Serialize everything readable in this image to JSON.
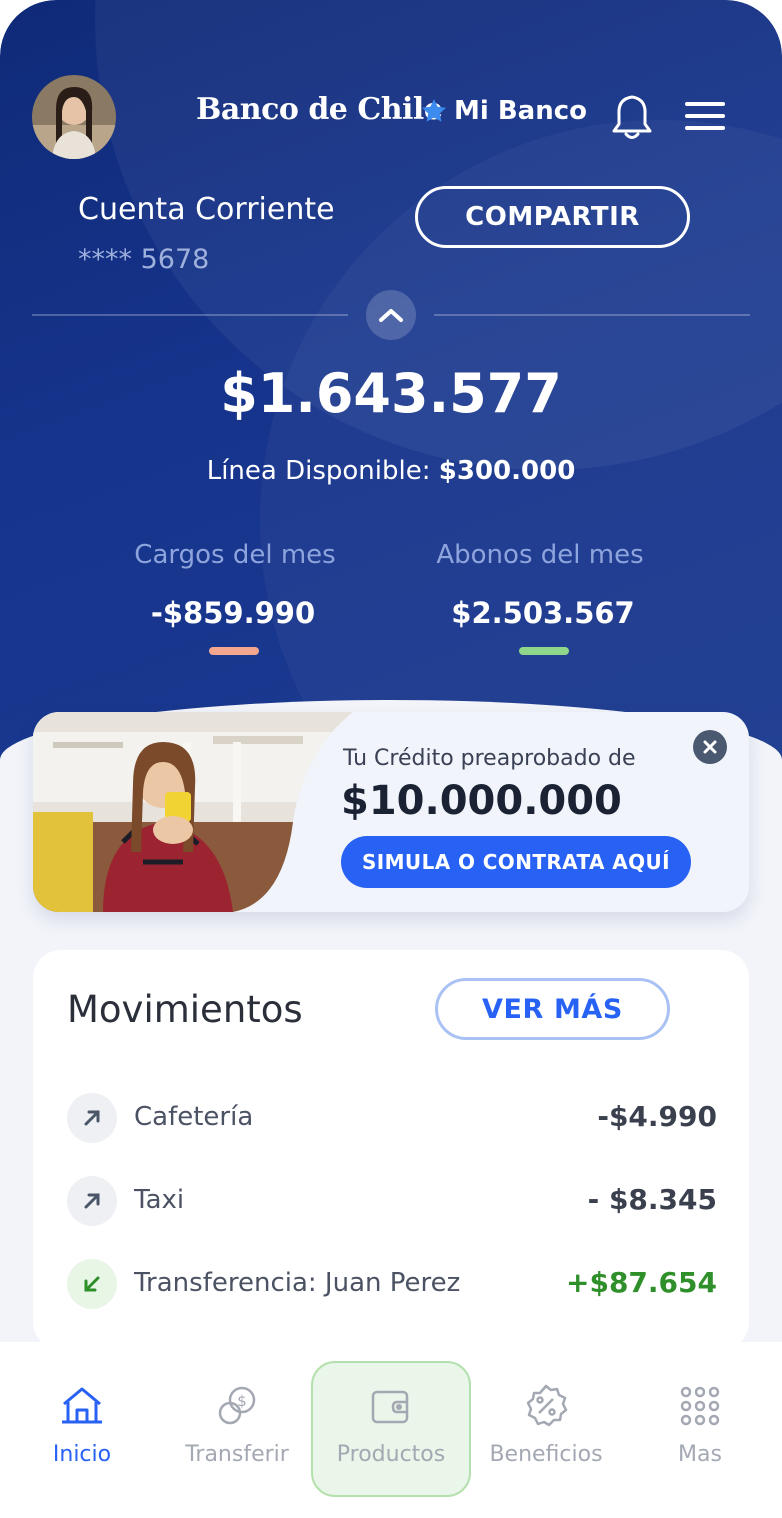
{
  "header": {
    "brand": "Banco de Chile",
    "mi_banco": "Mi Banco"
  },
  "account": {
    "name": "Cuenta Corriente",
    "number": "**** 5678",
    "share_label": "COMPARTIR"
  },
  "balance": {
    "amount": "$1.643.577",
    "linea_label": "Línea Disponible:",
    "linea_value": "$300.000"
  },
  "stats": {
    "cargos_label": "Cargos del mes",
    "cargos_value": "-$859.990",
    "abonos_label": "Abonos del mes",
    "abonos_value": "$2.503.567"
  },
  "promo": {
    "subtitle": "Tu Crédito preaprobado de",
    "amount": "$10.000.000",
    "cta": "SIMULA O CONTRATA AQUÍ"
  },
  "movements": {
    "title": "Movimientos",
    "more_label": "VER MÁS",
    "items": [
      {
        "label": "Cafetería",
        "amount": "-$4.990",
        "direction": "out"
      },
      {
        "label": "Taxi",
        "amount": "- $8.345",
        "direction": "out"
      },
      {
        "label": "Transferencia: Juan Perez",
        "amount": "+$87.654",
        "direction": "in"
      }
    ]
  },
  "tabs": [
    {
      "label": "Inicio",
      "icon": "home-icon"
    },
    {
      "label": "Transferir",
      "icon": "transfer-coins-icon"
    },
    {
      "label": "Productos",
      "icon": "wallet-icon"
    },
    {
      "label": "Beneficios",
      "icon": "percent-badge-icon"
    },
    {
      "label": "Mas",
      "icon": "grid-icon"
    }
  ],
  "colors": {
    "hero": "#16348c",
    "accent": "#2862f5",
    "cargos_bar": "#f4a68f",
    "abonos_bar": "#8fd78a",
    "positive": "#2f8f2a"
  }
}
